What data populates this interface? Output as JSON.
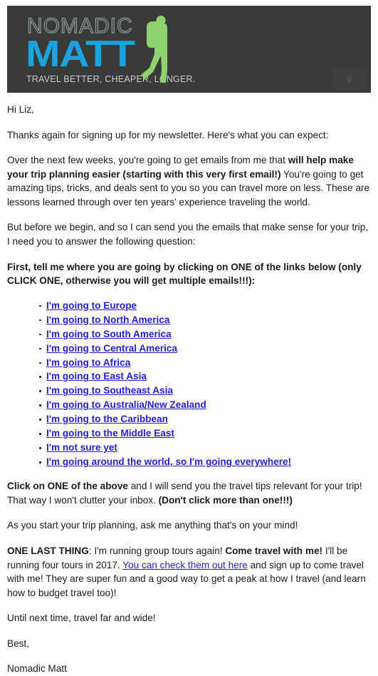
{
  "banner": {
    "logo_top": "NOMADIC",
    "logo_main": "MATT",
    "tagline": "TRAVEL BETTER, CHEAPER, LONGER.",
    "background_color": "#3a3a3a",
    "logo_main_color": "#1ba3dd",
    "logo_top_color": "#8d9b9b",
    "tagline_color": "#c8cccc",
    "backpacker_color": "#8ed26e"
  },
  "email": {
    "greeting": "Hi Liz,",
    "p_thanks": "Thanks again for signing up for my newsletter. Here's what you can expect:",
    "p_weeks_1": "Over the next few weeks, you're going to get emails from me that ",
    "p_weeks_bold": "will help make your trip planning easier (starting with this very first email!)",
    "p_weeks_2": " You're going to get amazing tips, tricks, and deals sent to you so you can travel more on less. These are lessons learned through over ten years' experience traveling the world.",
    "p_before": "But before we begin, and so I can send you the emails that make sense for your trip, I need you to answer the following question:",
    "p_first_bold": "First, tell me where you are going by clicking on ONE of the links below (only CLICK ONE, otherwise you will get multiple emails!!!):",
    "links": [
      "I'm going to Europe",
      "I'm going to North America",
      "I'm going to South America",
      "I'm going to Central America",
      "I'm going to Africa",
      "I'm going to East Asia",
      "I'm going to Southeast Asia",
      "I'm going to Australia/New Zealand",
      "I'm going to the Caribbean",
      "I'm going to the Middle East",
      "I'm not sure yet",
      "I'm going around the world, so I'm going everywhere!"
    ],
    "p_click_bold_1": "Click on ONE of the above",
    "p_click_mid": " and I will send you the travel tips relevant for your trip! That way I won't clutter your inbox. ",
    "p_click_bold_2": "(Don't click more than one!!!)",
    "p_ask": "As you start your trip planning, ask me anything that's on your mind!",
    "p_last_bold_1": "ONE LAST THING",
    "p_last_1": ": I'm running group tours again! ",
    "p_last_bold_2": "Come travel with me!",
    "p_last_2": " I'll be running four tours in 2017. ",
    "p_last_link": "You can check them out here",
    "p_last_3": " and sign up to come travel with me! They are super fun and a good way to get a peak at how I travel (and learn how to budget travel too)!",
    "p_until": "Until next time, travel far and wide!",
    "p_best": "Best,",
    "p_signature": "Nomadic Matt",
    "link_color": "#2222dd"
  }
}
